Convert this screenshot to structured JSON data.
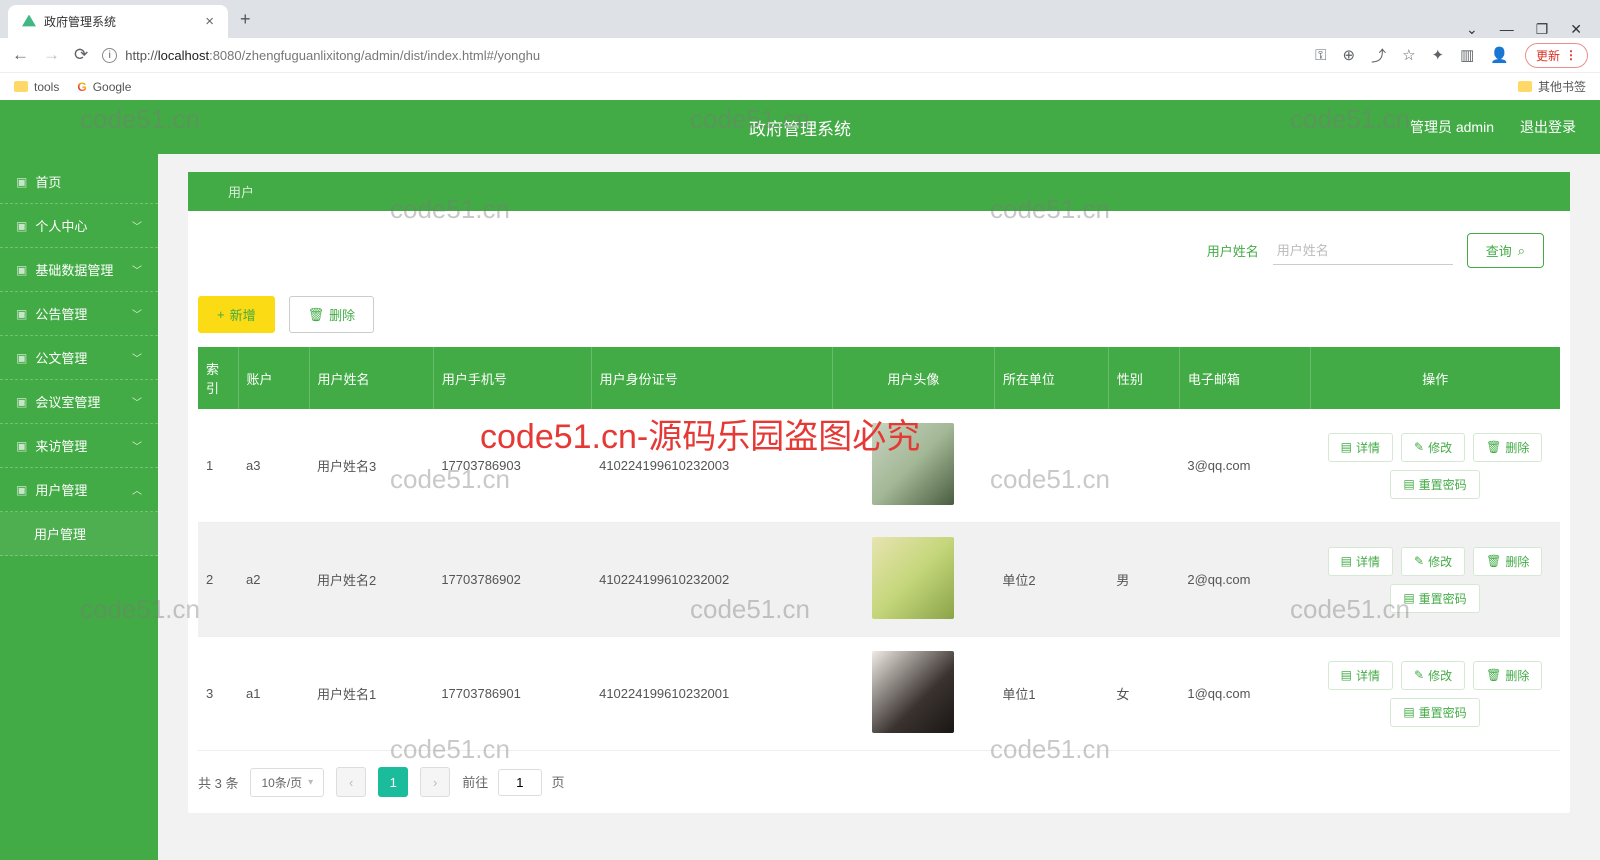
{
  "browser": {
    "tab_title": "政府管理系统",
    "url_prefix": "http://",
    "url_host": "localhost",
    "url_port_path": ":8080/zhengfuguanlixitong/admin/dist/index.html#/yonghu",
    "update_label": "更新",
    "bookmarks": {
      "tools": "tools",
      "google": "Google",
      "other": "其他书签"
    }
  },
  "header": {
    "title": "政府管理系统",
    "user": "管理员 admin",
    "logout": "退出登录"
  },
  "sidebar": {
    "items": [
      {
        "label": "首页",
        "chev": ""
      },
      {
        "label": "个人中心",
        "chev": "﹀"
      },
      {
        "label": "基础数据管理",
        "chev": "﹀"
      },
      {
        "label": "公告管理",
        "chev": "﹀"
      },
      {
        "label": "公文管理",
        "chev": "﹀"
      },
      {
        "label": "会议室管理",
        "chev": "﹀"
      },
      {
        "label": "来访管理",
        "chev": "﹀"
      },
      {
        "label": "用户管理",
        "chev": "︿"
      }
    ],
    "sub_item": "用户管理"
  },
  "breadcrumb": "用户",
  "search": {
    "label": "用户姓名",
    "placeholder": "用户姓名",
    "query": "查询"
  },
  "toolbar": {
    "add": "新增",
    "del": "删除"
  },
  "table": {
    "headers": [
      "索引",
      "账户",
      "用户姓名",
      "用户手机号",
      "用户身份证号",
      "用户头像",
      "所在单位",
      "性别",
      "电子邮箱",
      "操作"
    ],
    "ops": {
      "detail": "详情",
      "edit": "修改",
      "del": "删除",
      "reset": "重置密码"
    },
    "rows": [
      {
        "idx": "1",
        "acct": "a3",
        "name": "用户姓名3",
        "phone": "17703786903",
        "idcard": "410224199610232003",
        "unit": "",
        "gender": "",
        "email": "3@qq.com"
      },
      {
        "idx": "2",
        "acct": "a2",
        "name": "用户姓名2",
        "phone": "17703786902",
        "idcard": "410224199610232002",
        "unit": "单位2",
        "gender": "男",
        "email": "2@qq.com"
      },
      {
        "idx": "3",
        "acct": "a1",
        "name": "用户姓名1",
        "phone": "17703786901",
        "idcard": "410224199610232001",
        "unit": "单位1",
        "gender": "女",
        "email": "1@qq.com"
      }
    ]
  },
  "pagination": {
    "total": "共 3 条",
    "page_size": "10条/页",
    "current": "1",
    "goto_pre": "前往",
    "goto_val": "1",
    "goto_suf": "页"
  },
  "watermarks": {
    "red": "code51.cn-源码乐园盗图必究",
    "grey": "code51.cn"
  }
}
